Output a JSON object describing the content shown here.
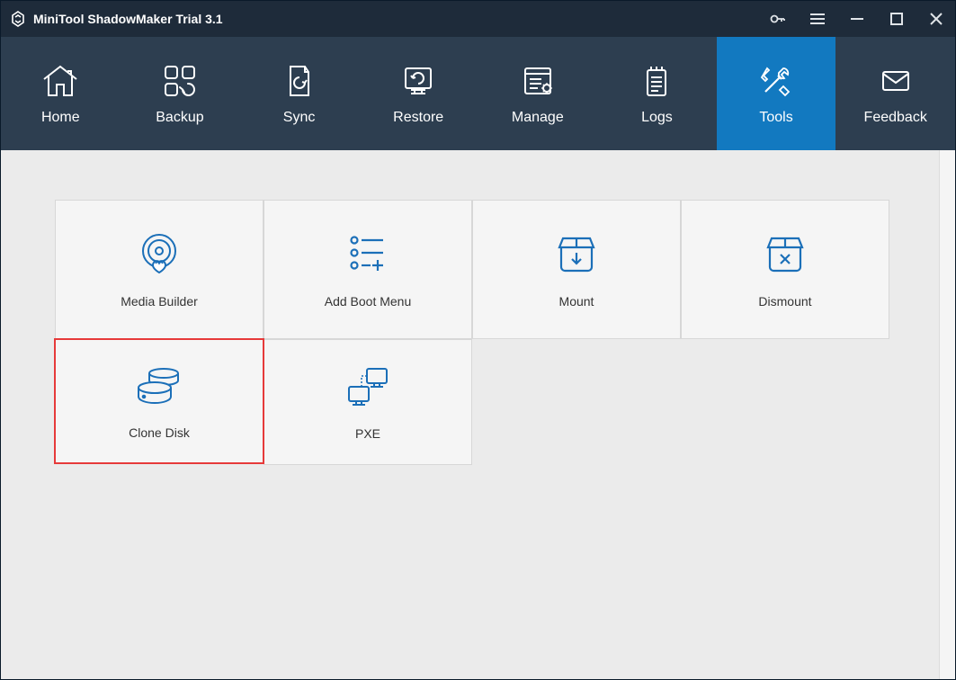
{
  "app": {
    "title": "MiniTool ShadowMaker Trial 3.1"
  },
  "nav": {
    "items": [
      {
        "label": "Home"
      },
      {
        "label": "Backup"
      },
      {
        "label": "Sync"
      },
      {
        "label": "Restore"
      },
      {
        "label": "Manage"
      },
      {
        "label": "Logs"
      },
      {
        "label": "Tools"
      },
      {
        "label": "Feedback"
      }
    ]
  },
  "tools": {
    "items": [
      {
        "label": "Media Builder"
      },
      {
        "label": "Add Boot Menu"
      },
      {
        "label": "Mount"
      },
      {
        "label": "Dismount"
      },
      {
        "label": "Clone Disk"
      },
      {
        "label": "PXE"
      }
    ]
  },
  "colors": {
    "accent": "#1279c0",
    "iconBlue": "#1b6fb8",
    "highlight": "#e63a3a"
  }
}
